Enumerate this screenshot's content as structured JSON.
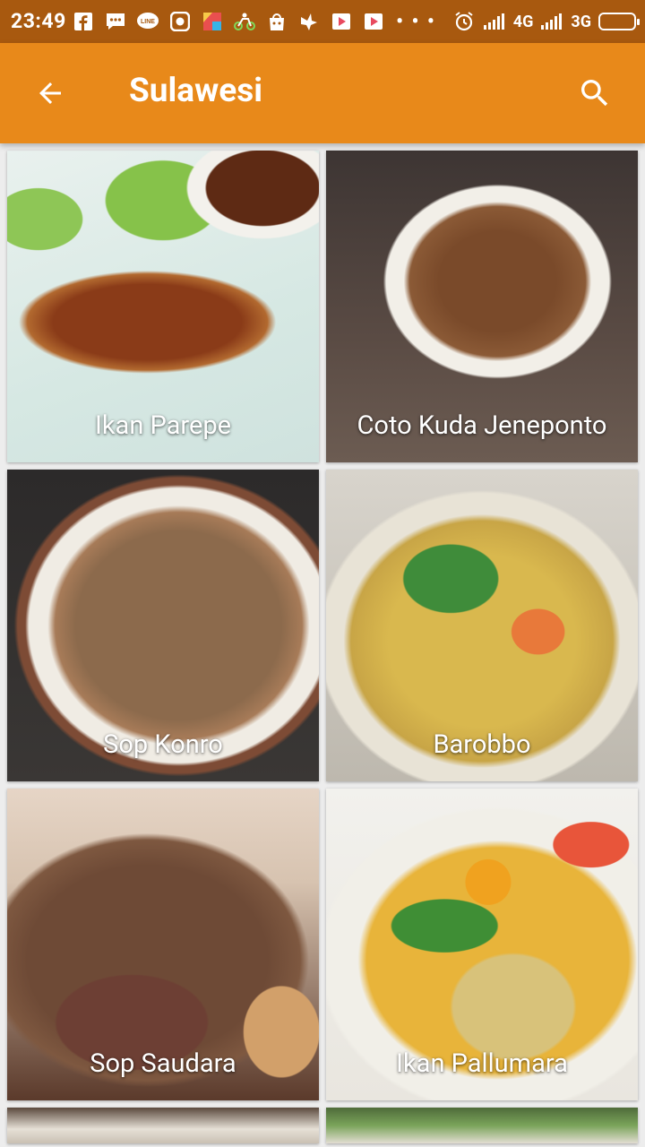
{
  "status_bar": {
    "time": "23:49",
    "left_icons": [
      "facebook-icon",
      "messenger-icon",
      "line-icon",
      "camera-app-icon",
      "photos-icon",
      "bike-icon",
      "shop-icon",
      "bird-icon",
      "play-store-icon",
      "play-store-icon"
    ],
    "overflow": "• • •",
    "network_1": "4G",
    "network_2": "3G"
  },
  "app_bar": {
    "title": "Sulawesi",
    "back_icon": "arrow-back-icon",
    "search_icon": "search-icon",
    "color": "#e8891a"
  },
  "foods": [
    {
      "name": "Ikan Parepe"
    },
    {
      "name": "Coto Kuda Jeneponto"
    },
    {
      "name": "Sop Konro"
    },
    {
      "name": "Barobbo"
    },
    {
      "name": "Sop Saudara"
    },
    {
      "name": "Ikan Pallumara"
    }
  ]
}
